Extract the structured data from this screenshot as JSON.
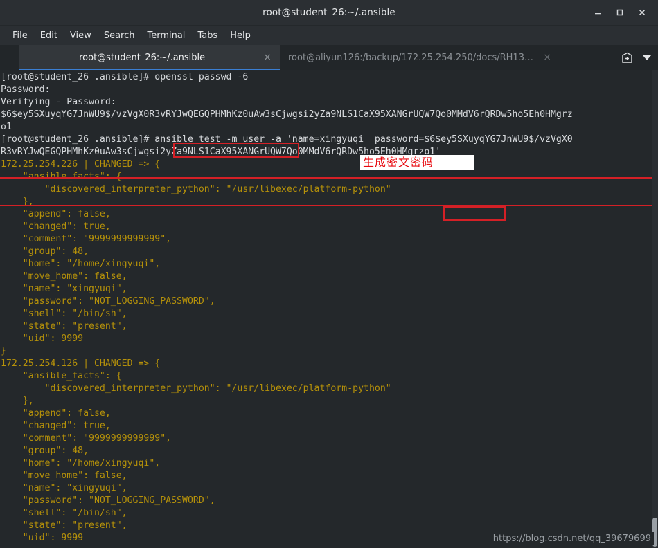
{
  "window": {
    "title": "root@student_26:~/.ansible",
    "controls": [
      {
        "name": "minimize",
        "glyph": "—"
      },
      {
        "name": "maximize",
        "glyph": "□"
      },
      {
        "name": "close",
        "glyph": "✕"
      }
    ]
  },
  "menubar": {
    "items": [
      "File",
      "Edit",
      "View",
      "Search",
      "Terminal",
      "Tabs",
      "Help"
    ]
  },
  "tabs": [
    {
      "label": "root@student_26:~/.ansible",
      "close": "×",
      "active": true
    },
    {
      "label": "root@aliyun126:/backup/172.25.254.250/docs/RH135…",
      "close": "×",
      "active": false
    }
  ],
  "tabbar_actions": {
    "new_tab_icon": "⊞",
    "dropdown_icon": "▼"
  },
  "terminal": {
    "lines": [
      {
        "text": "[root@student_26 .ansible]# openssl passwd -6",
        "style": "plain"
      },
      {
        "text": "Password:",
        "style": "plain"
      },
      {
        "text": "Verifying - Password:",
        "style": "plain"
      },
      {
        "text": "$6$ey5SXuyqYG7JnWU9$/vzVgX0R3vRYJwQEGQPHMhKz0uAw3sCjwgsi2yZa9NLS1CaX95XANGrUQW7Qo0MMdV6rQRDw5ho5Eh0HMgrz",
        "style": "plain"
      },
      {
        "text": "o1",
        "style": "plain"
      },
      {
        "text": "[root@student_26 .ansible]# ansible test -m user -a 'name=xingyuqi  password=$6$ey5SXuyqYG7JnWU9$/vzVgX0",
        "style": "plain"
      },
      {
        "text": "R3vRYJwQEGQPHMhKz0uAw3sCjwgsi2yZa9NLS1CaX95XANGrUQW7Qo0MMdV6rQRDw5ho5Eh0HMgrzo1'",
        "style": "plain"
      },
      {
        "text": "172.25.254.226 | CHANGED => {",
        "style": "json"
      },
      {
        "text": "    \"ansible_facts\": {",
        "style": "json"
      },
      {
        "text": "        \"discovered_interpreter_python\": \"/usr/libexec/platform-python\"",
        "style": "json"
      },
      {
        "text": "    },",
        "style": "json"
      },
      {
        "text": "    \"append\": false,",
        "style": "json"
      },
      {
        "text": "    \"changed\": true,",
        "style": "json"
      },
      {
        "text": "    \"comment\": \"9999999999999\",",
        "style": "json"
      },
      {
        "text": "    \"group\": 48,",
        "style": "json"
      },
      {
        "text": "    \"home\": \"/home/xingyuqi\",",
        "style": "json"
      },
      {
        "text": "    \"move_home\": false,",
        "style": "json"
      },
      {
        "text": "    \"name\": \"xingyuqi\",",
        "style": "json"
      },
      {
        "text": "    \"password\": \"NOT_LOGGING_PASSWORD\",",
        "style": "json"
      },
      {
        "text": "    \"shell\": \"/bin/sh\",",
        "style": "json"
      },
      {
        "text": "    \"state\": \"present\",",
        "style": "json"
      },
      {
        "text": "    \"uid\": 9999",
        "style": "json"
      },
      {
        "text": "}",
        "style": "json"
      },
      {
        "text": "172.25.254.126 | CHANGED => {",
        "style": "json"
      },
      {
        "text": "    \"ansible_facts\": {",
        "style": "json"
      },
      {
        "text": "        \"discovered_interpreter_python\": \"/usr/libexec/platform-python\"",
        "style": "json"
      },
      {
        "text": "    },",
        "style": "json"
      },
      {
        "text": "    \"append\": false,",
        "style": "json"
      },
      {
        "text": "    \"changed\": true,",
        "style": "json"
      },
      {
        "text": "    \"comment\": \"9999999999999\",",
        "style": "json"
      },
      {
        "text": "    \"group\": 48,",
        "style": "json"
      },
      {
        "text": "    \"home\": \"/home/xingyuqi\",",
        "style": "json"
      },
      {
        "text": "    \"move_home\": false,",
        "style": "json"
      },
      {
        "text": "    \"name\": \"xingyuqi\",",
        "style": "json"
      },
      {
        "text": "    \"password\": \"NOT_LOGGING_PASSWORD\",",
        "style": "json"
      },
      {
        "text": "    \"shell\": \"/bin/sh\",",
        "style": "json"
      },
      {
        "text": "    \"state\": \"present\",",
        "style": "json"
      },
      {
        "text": "    \"uid\": 9999",
        "style": "json"
      }
    ]
  },
  "annotations": {
    "note_text": "生成密文密码",
    "box_color": "#d42026"
  },
  "watermark": {
    "text": "https://blog.csdn.net/qq_39679699"
  }
}
